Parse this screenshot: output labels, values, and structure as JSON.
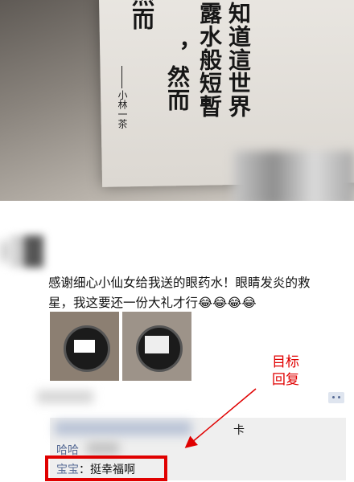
{
  "post": {
    "text_line1": "感谢细心小仙女给我送的眼药水！眼睛发炎的救",
    "text_line2": "星，我这要还一份大礼才行",
    "emoji": "😂😂😂😂",
    "image_count": 2
  },
  "banner": {
    "poem_cols": [
      "知道這世界",
      "露水般短暫",
      "，然而",
      "然而"
    ],
    "signature": "小林一茶"
  },
  "comments": {
    "partial_suffix": "卡",
    "second_name_partial": "哈哈",
    "reply_name": "宝宝",
    "reply_sep": "：",
    "reply_text": "挺幸福啊"
  },
  "annotation": {
    "line1": "目标",
    "line2": "回复"
  },
  "colors": {
    "link": "#576b95",
    "annotation": "#e00000",
    "comment_bg": "#efefef"
  }
}
